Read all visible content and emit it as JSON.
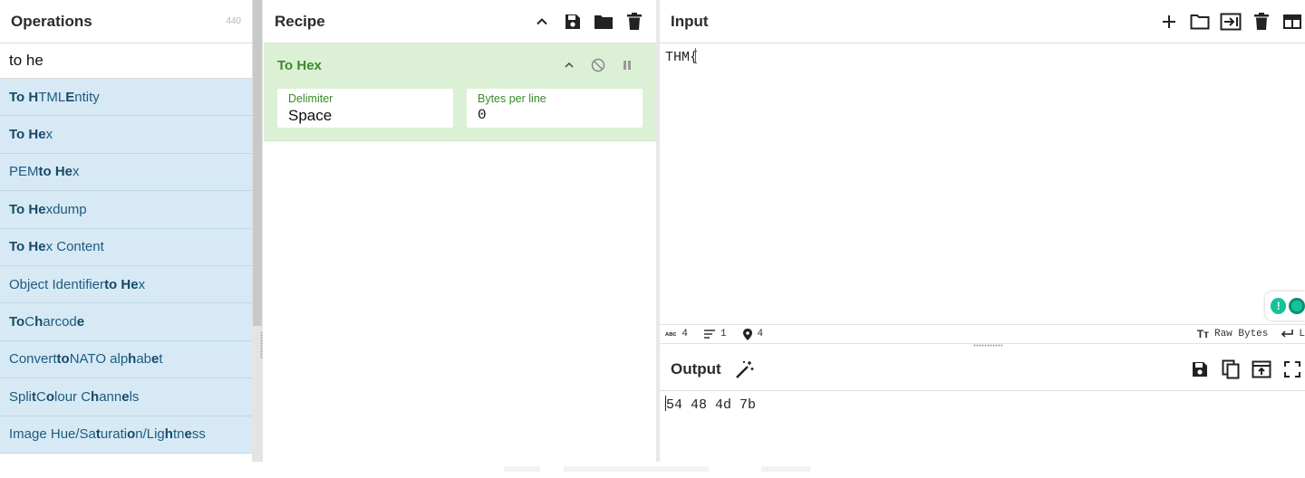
{
  "operations": {
    "title": "Operations",
    "count": "440",
    "search_value": "to he",
    "items": [
      {
        "html": "<b>To H</b>TML <b>E</b>ntity"
      },
      {
        "html": "<b>To He</b>x"
      },
      {
        "html": "PEM <b>to He</b>x"
      },
      {
        "html": "<b>To He</b>xdump"
      },
      {
        "html": "<b>To He</b>x Content"
      },
      {
        "html": "Object Identifier <b>to He</b>x"
      },
      {
        "html": "<b>To</b> C<b>h</b>arcod<b>e</b>"
      },
      {
        "html": "Convert <b>to</b> NATO alp<b>h</b>ab<b>e</b>t"
      },
      {
        "html": "Spli<b>t</b> C<b>o</b>lour C<b>h</b>ann<b>e</b>ls"
      },
      {
        "html": "Image Hue/Sa<b>t</b>urati<b>o</b>n/Lig<b>h</b>tn<b>e</b>ss"
      }
    ]
  },
  "recipe": {
    "title": "Recipe",
    "operation": {
      "name": "To Hex",
      "args": [
        {
          "label": "Delimiter",
          "value": "Space"
        },
        {
          "label": "Bytes per line",
          "value": "0"
        }
      ]
    }
  },
  "input": {
    "title": "Input",
    "text": "THM{",
    "status": {
      "chars": "4",
      "lines": "1",
      "position": "4",
      "encoding": "Raw Bytes",
      "eol": "L"
    }
  },
  "output": {
    "title": "Output",
    "text": "54 48 4d 7b"
  }
}
